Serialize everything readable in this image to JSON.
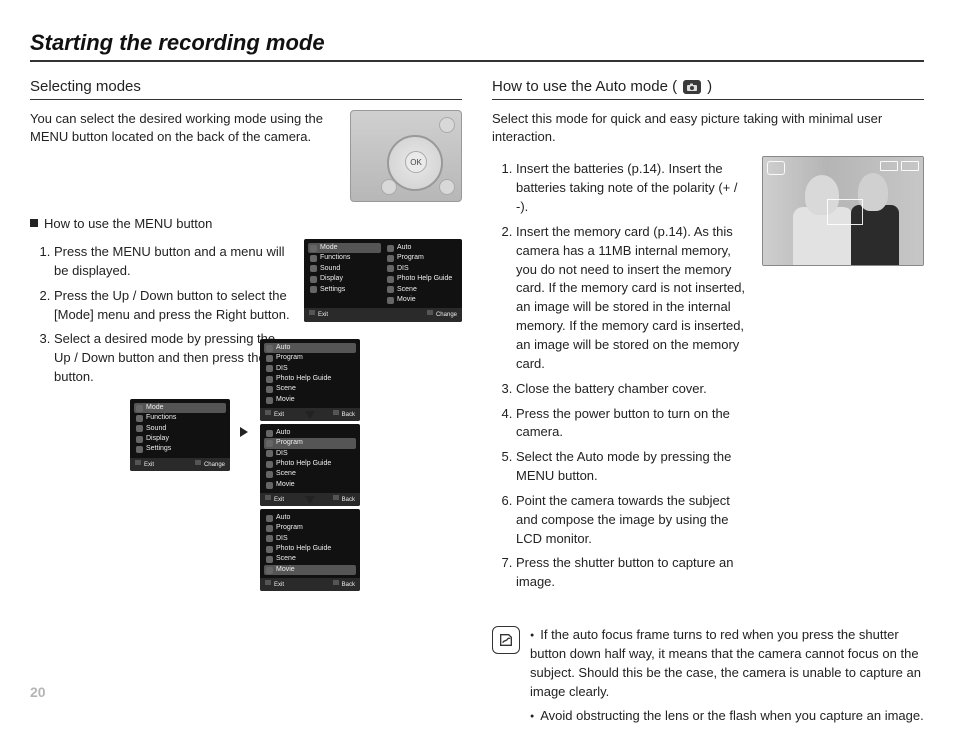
{
  "page_number": "20",
  "page_title": "Starting the recording mode",
  "left": {
    "heading": "Selecting modes",
    "intro": "You can select the desired working mode using the MENU button located on the back of the camera.",
    "menu_button_heading": "How to use the MENU button",
    "steps": [
      "Press the MENU button and a menu will be displayed.",
      "Press the Up / Down button to select the [Mode] menu and press the Right button.",
      "Select a desired mode by pressing the Up / Down button and then press the OK button."
    ],
    "camera_ok_label": "OK",
    "menu_left_items": [
      "Mode",
      "Functions",
      "Sound",
      "Display",
      "Settings"
    ],
    "menu_right_items": [
      "Auto",
      "Program",
      "DIS",
      "Photo Help Guide",
      "Scene",
      "Movie"
    ],
    "menu_footer_left": "Exit",
    "menu_footer_change": "Change",
    "menu_footer_back": "Back"
  },
  "right": {
    "heading_prefix": "How to use the Auto mode (",
    "heading_suffix": " )",
    "intro": "Select this mode for quick and easy picture taking with minimal user interaction.",
    "steps": [
      "Insert the batteries (p.14). Insert the batteries taking note of the polarity (+ / -).",
      "Insert the memory card (p.14). As this camera has a 11MB internal memory, you do not need to insert the memory card. If the memory card is not inserted, an image will be stored in the internal memory. If the memory card is inserted, an image will be stored on the memory card.",
      "Close the battery chamber cover.",
      "Press the power button to turn on the camera.",
      "Select the Auto mode by pressing the MENU button.",
      "Point the camera towards the subject and compose the image by using the LCD monitor.",
      "Press the shutter button to capture an image."
    ],
    "notes": [
      "If the auto focus frame turns to red when you press the shutter button down half way, it means that the camera cannot focus on the subject. Should this be the case, the camera is unable to capture an image clearly.",
      "Avoid obstructing the lens or the flash when you capture an image."
    ]
  }
}
